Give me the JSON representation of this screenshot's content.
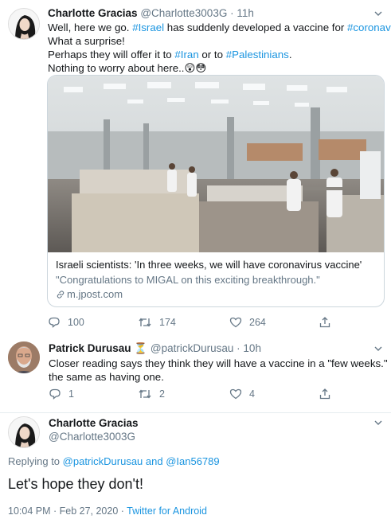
{
  "tweet1": {
    "name": "Charlotte Gracias",
    "handle": "@Charlotte3003G",
    "separator": "·",
    "time": "11h",
    "lines": [
      [
        {
          "t": "Well, here we go. "
        },
        {
          "t": "#Israel",
          "link": true
        },
        {
          "t": " has suddenly developed a vaccine for "
        },
        {
          "t": "#coronavirus",
          "link": true
        }
      ],
      [
        {
          "t": "What a surprise!"
        }
      ],
      [
        {
          "t": "Perhaps they will offer it to "
        },
        {
          "t": "#Iran",
          "link": true
        },
        {
          "t": " or to "
        },
        {
          "t": "#Palestinians",
          "link": true
        },
        {
          "t": "."
        }
      ],
      [
        {
          "t": "Nothing to worry about here..😲😳"
        }
      ]
    ],
    "card": {
      "title": "Israeli scientists: 'In three weeks, we will have coronavirus vaccine'",
      "description": "\"Congratulations to MIGAL on this exciting breakthrough.\"",
      "domain": "m.jpost.com"
    },
    "replies": "100",
    "retweets": "174",
    "likes": "264"
  },
  "tweet2": {
    "name": "Patrick Durusau",
    "badge": "⏳",
    "handle": "@patrickDurusau",
    "separator": "·",
    "time": "10h",
    "lines": [
      "Closer reading says they think they will have a vaccine in a \"few weeks.\" Not",
      "the same as having one."
    ],
    "replies": "1",
    "retweets": "2",
    "likes": "4"
  },
  "tweet3": {
    "name": "Charlotte Gracias",
    "handle": "@Charlotte3003G",
    "replying_prefix": "Replying to ",
    "replying_user1": "@patrickDurusau",
    "replying_and": " and ",
    "replying_user2": "@Ian56789",
    "text": "Let's hope they don't!",
    "timestamp": "10:04 PM · Feb 27, 2020",
    "separator": " · ",
    "source": "Twitter for Android"
  },
  "colors": {
    "link": "#1b95e0",
    "muted": "#657786",
    "text": "#14171a",
    "border": "#e6ecf0"
  }
}
